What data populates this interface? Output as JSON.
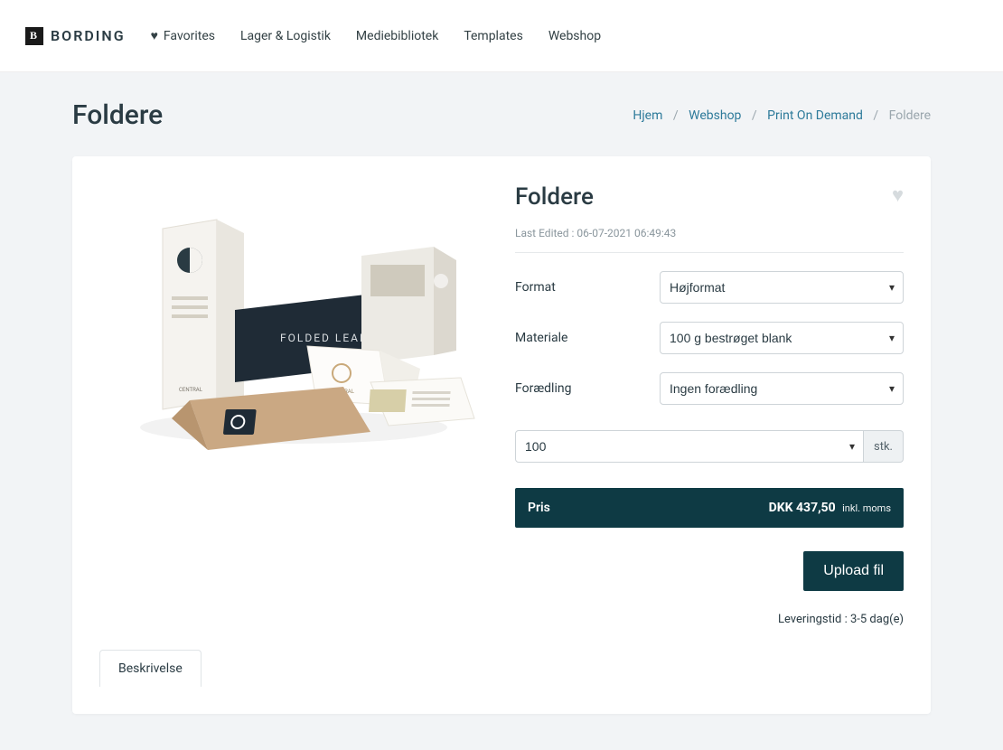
{
  "brand": "BORDING",
  "nav": {
    "favorites": "Favorites",
    "lager": "Lager & Logistik",
    "medie": "Mediebibliotek",
    "templates": "Templates",
    "webshop": "Webshop"
  },
  "page": {
    "title": "Foldere"
  },
  "breadcrumb": {
    "hjem": "Hjem",
    "webshop": "Webshop",
    "pod": "Print On Demand",
    "current": "Foldere"
  },
  "product": {
    "title": "Foldere",
    "last_edited": "Last Edited : 06-07-2021 06:49:43",
    "image_text": "FOLDED LEAFLETS",
    "image_brand": "CENTRAL",
    "options": {
      "format": {
        "label": "Format",
        "value": "Højformat"
      },
      "materiale": {
        "label": "Materiale",
        "value": "100 g bestrøget blank"
      },
      "foraedling": {
        "label": "Forædling",
        "value": "Ingen forædling"
      }
    },
    "quantity": {
      "value": "100",
      "unit": "stk."
    },
    "price": {
      "label": "Pris",
      "amount": "DKK 437,50",
      "incl": "inkl. moms"
    },
    "upload": "Upload fil",
    "delivery": "Leveringstid : 3-5 dag(e)"
  },
  "tabs": {
    "beskrivelse": "Beskrivelse"
  }
}
